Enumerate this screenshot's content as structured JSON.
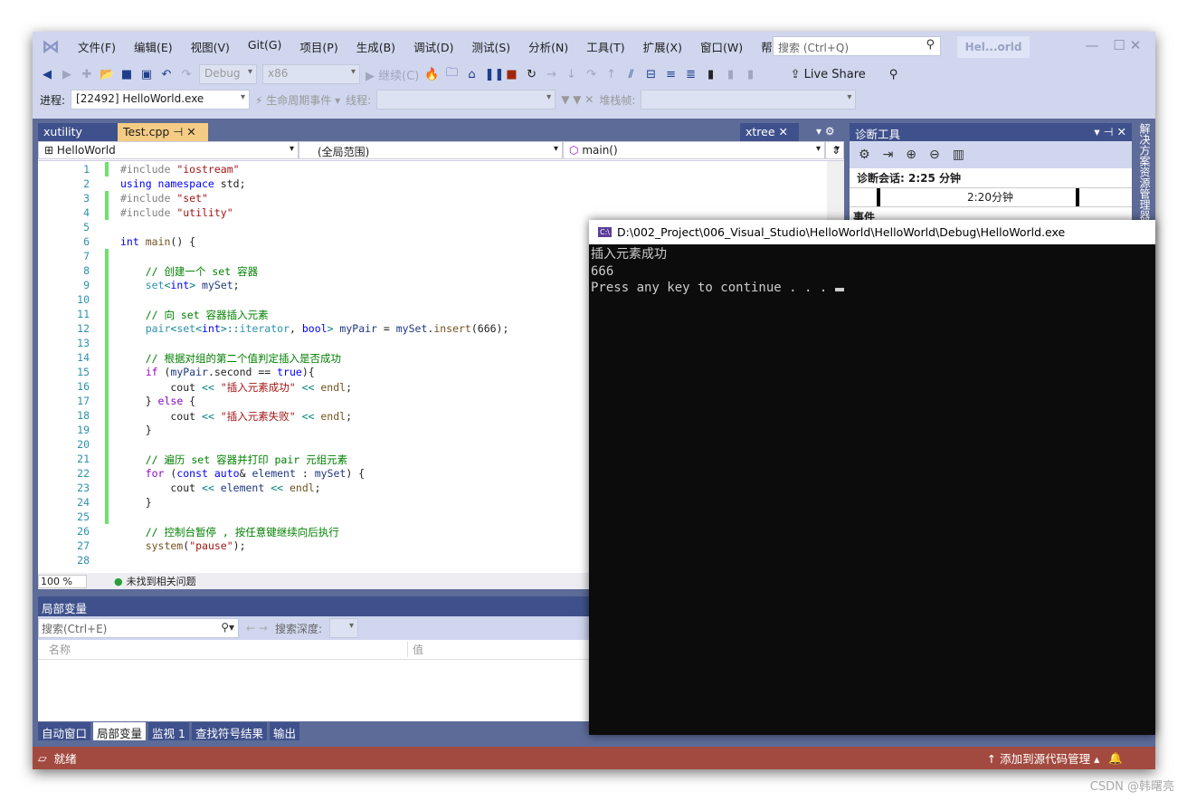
{
  "menu": {
    "items": [
      "文件(F)",
      "编辑(E)",
      "视图(V)",
      "Git(G)",
      "项目(P)",
      "生成(B)",
      "调试(D)",
      "测试(S)",
      "分析(N)",
      "工具(T)",
      "扩展(X)",
      "窗口(W)",
      "帮助(H)"
    ],
    "search_placeholder": "搜索 (Ctrl+Q)",
    "title": "Hel...orld"
  },
  "toolbar": {
    "config": "Debug",
    "platform": "x86",
    "continue": "继续(C)",
    "live_share": "Live Share"
  },
  "toolbar2": {
    "process_label": "进程:",
    "process": "[22492] HelloWorld.exe",
    "lifecycle": "生命周期事件",
    "thread_label": "线程:",
    "stack_label": "堆栈帧:"
  },
  "tabs": {
    "inactive": "xutility",
    "active": "Test.cpp",
    "right": "xtree"
  },
  "navbar": {
    "project": "HelloWorld",
    "scope": "(全局范围)",
    "member": "main()"
  },
  "code": [
    [
      [
        "#include ",
        "pp"
      ],
      [
        "\"iostream\"",
        "st"
      ]
    ],
    [
      [
        "using ",
        "kw"
      ],
      [
        "namespace ",
        "kw"
      ],
      [
        "std;",
        "tx"
      ]
    ],
    [
      [
        "#include ",
        "pp"
      ],
      [
        "\"set\"",
        "st"
      ]
    ],
    [
      [
        "#include ",
        "pp"
      ],
      [
        "\"utility\"",
        "st"
      ]
    ],
    [],
    [
      [
        "int ",
        "kw"
      ],
      [
        "main",
        "fn"
      ],
      [
        "() {",
        "tx"
      ]
    ],
    [],
    [
      [
        "    // 创建一个 set 容器",
        "cm"
      ]
    ],
    [
      [
        "    set",
        "ty"
      ],
      [
        "<",
        "op"
      ],
      [
        "int",
        "kw"
      ],
      [
        "> ",
        "op"
      ],
      [
        "mySet",
        "va"
      ],
      [
        ";",
        "tx"
      ]
    ],
    [],
    [
      [
        "    // 向 set 容器插入元素",
        "cm"
      ]
    ],
    [
      [
        "    pair",
        "ty"
      ],
      [
        "<",
        "op"
      ],
      [
        "set",
        "ty"
      ],
      [
        "<",
        "op"
      ],
      [
        "int",
        "kw"
      ],
      [
        ">::",
        "op"
      ],
      [
        "iterator",
        "ty"
      ],
      [
        ", ",
        "tx"
      ],
      [
        "bool",
        "kw"
      ],
      [
        "> ",
        "op"
      ],
      [
        "myPair",
        "va"
      ],
      [
        " = ",
        "tx"
      ],
      [
        "mySet",
        "va"
      ],
      [
        ".",
        "tx"
      ],
      [
        "insert",
        "fn"
      ],
      [
        "(666);",
        "tx"
      ]
    ],
    [],
    [
      [
        "    // 根据对组的第二个值判定插入是否成功",
        "cm"
      ]
    ],
    [
      [
        "    if ",
        "ct"
      ],
      [
        "(",
        "tx"
      ],
      [
        "myPair",
        "va"
      ],
      [
        ".second == ",
        "tx"
      ],
      [
        "true",
        "kw"
      ],
      [
        "){",
        "tx"
      ]
    ],
    [
      [
        "        cout ",
        "tx"
      ],
      [
        "<< ",
        "op"
      ],
      [
        "\"插入元素成功\"",
        "st"
      ],
      [
        " << ",
        "op"
      ],
      [
        "endl",
        "fn"
      ],
      [
        ";",
        "tx"
      ]
    ],
    [
      [
        "    } ",
        "tx"
      ],
      [
        "else ",
        "ct"
      ],
      [
        "{",
        "tx"
      ]
    ],
    [
      [
        "        cout ",
        "tx"
      ],
      [
        "<< ",
        "op"
      ],
      [
        "\"插入元素失败\"",
        "st"
      ],
      [
        " << ",
        "op"
      ],
      [
        "endl",
        "fn"
      ],
      [
        ";",
        "tx"
      ]
    ],
    [
      [
        "    }",
        "tx"
      ]
    ],
    [],
    [
      [
        "    // 遍历 set 容器并打印 pair 元组元素",
        "cm"
      ]
    ],
    [
      [
        "    for ",
        "ct"
      ],
      [
        "(",
        "tx"
      ],
      [
        "const ",
        "kw"
      ],
      [
        "auto",
        "kw"
      ],
      [
        "& ",
        "tx"
      ],
      [
        "element",
        "va"
      ],
      [
        " : ",
        "tx"
      ],
      [
        "mySet",
        "va"
      ],
      [
        ") {",
        "tx"
      ]
    ],
    [
      [
        "        cout ",
        "tx"
      ],
      [
        "<< ",
        "op"
      ],
      [
        "element",
        "va"
      ],
      [
        " << ",
        "op"
      ],
      [
        "endl",
        "fn"
      ],
      [
        ";",
        "tx"
      ]
    ],
    [
      [
        "    }",
        "tx"
      ]
    ],
    [],
    [
      [
        "    // 控制台暂停 , 按任意键继续向后执行",
        "cm"
      ]
    ],
    [
      [
        "    system",
        "fn"
      ],
      [
        "(",
        "tx"
      ],
      [
        "\"pause\"",
        "st"
      ],
      [
        ");",
        "tx"
      ]
    ],
    []
  ],
  "editor_status": {
    "zoom": "100 %",
    "issues": "未找到相关问题"
  },
  "diagnostics": {
    "title": "诊断工具",
    "session": "诊断会话: 2:25 分钟",
    "timeline_label": "2:20分钟",
    "events": "事件"
  },
  "side_panel": "解决方案资源管理器",
  "locals": {
    "title": "局部变量",
    "search_placeholder": "搜索(Ctrl+E)",
    "depth_label": "搜索深度:",
    "col_name": "名称",
    "col_value": "值"
  },
  "bottom_tabs": [
    "自动窗口",
    "局部变量",
    "监视 1",
    "查找符号结果",
    "输出"
  ],
  "status": {
    "ready": "就绪",
    "source_control": "添加到源代码管理"
  },
  "console": {
    "title": "D:\\002_Project\\006_Visual_Studio\\HelloWorld\\HelloWorld\\Debug\\HelloWorld.exe",
    "output": "插入元素成功\n666\nPress any key to continue . . . "
  },
  "watermark": "CSDN @韩曙亮"
}
